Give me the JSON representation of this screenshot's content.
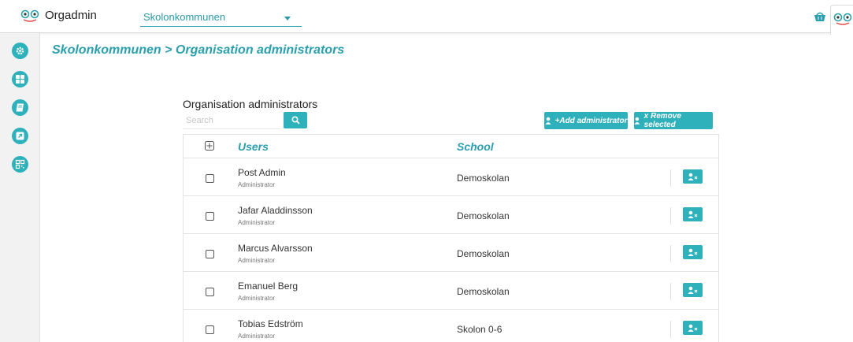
{
  "topbar": {
    "app_title": "Orgadmin",
    "org_select_value": "Skolonkommunen",
    "logo_icon": "owl-eyes-icon",
    "basket_icon": "basket-icon"
  },
  "sidebar": {
    "items": [
      {
        "icon": "gear-icon"
      },
      {
        "icon": "grid-icon"
      },
      {
        "icon": "book-icon"
      },
      {
        "icon": "external-link-icon"
      },
      {
        "icon": "qr-code-icon"
      }
    ]
  },
  "breadcrumb": {
    "org": "Skolonkommunen",
    "separator": " > ",
    "page": "Organisation administrators"
  },
  "panel": {
    "title": "Organisation administrators",
    "search_placeholder": "Search",
    "add_label": "+Add administrator",
    "remove_label": "x Remove selected"
  },
  "table": {
    "columns": [
      "Users",
      "School"
    ],
    "rows": [
      {
        "name": "Post Admin",
        "role": "Administrator",
        "school": "Demoskolan"
      },
      {
        "name": "Jafar Aladdinsson",
        "role": "Administrator",
        "school": "Demoskolan"
      },
      {
        "name": "Marcus Alvarsson",
        "role": "Administrator",
        "school": "Demoskolan"
      },
      {
        "name": "Emanuel Berg",
        "role": "Administrator",
        "school": "Demoskolan"
      },
      {
        "name": "Tobias Edström",
        "role": "Administrator",
        "school": "Skolon 0-6"
      }
    ]
  },
  "colors": {
    "accent": "#2fb1bc",
    "accent_text": "#2a9fad"
  }
}
